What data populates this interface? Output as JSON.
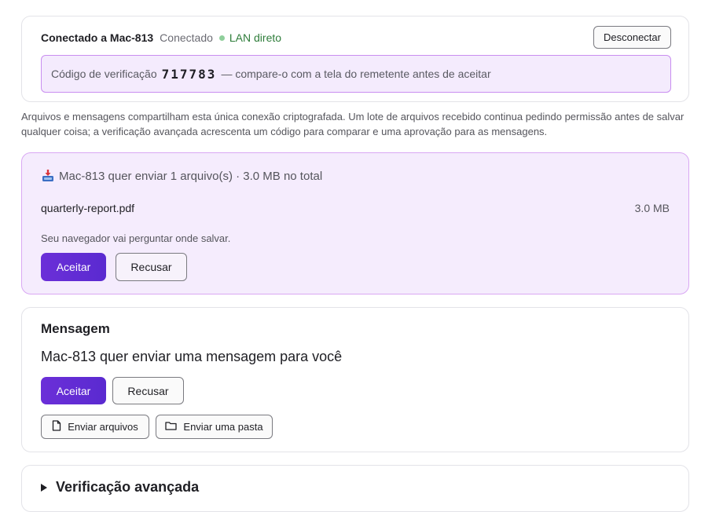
{
  "connection": {
    "title": "Conectado a Mac-813",
    "status": "Conectado",
    "link_type": "LAN direto",
    "disconnect_label": "Desconectar",
    "verification": {
      "label": "Código de verificação",
      "code": "717783",
      "hint": "— compare-o com a tela do remetente antes de aceitar"
    }
  },
  "info_text": "Arquivos e mensagens compartilham esta única conexão criptografada. Um lote de arquivos recebido continua pedindo permissão antes de salvar qualquer coisa; a verificação avançada acrescenta um código para comparar e uma aprovação para as mensagens.",
  "file_offer": {
    "icon": "inbox-tray-icon",
    "summary": "Mac-813 quer enviar 1 arquivo(s) · 3.0 MB no total",
    "files": [
      {
        "name": "quarterly-report.pdf",
        "size": "3.0 MB"
      }
    ],
    "save_note": "Seu navegador vai perguntar onde salvar.",
    "accept_label": "Aceitar",
    "decline_label": "Recusar"
  },
  "message": {
    "heading": "Mensagem",
    "text": "Mac-813 quer enviar uma mensagem para você",
    "accept_label": "Aceitar",
    "decline_label": "Recusar",
    "send_files_label": "Enviar arquivos",
    "send_folder_label": "Enviar uma pasta"
  },
  "advanced": {
    "label": "Verificação avançada"
  },
  "colors": {
    "accent": "#5b2bd4",
    "verify_bg": "#f4ebfd",
    "verify_border": "#c98ef0",
    "online_dot": "#8fcf9b",
    "lan_text": "#2e7d3a"
  }
}
